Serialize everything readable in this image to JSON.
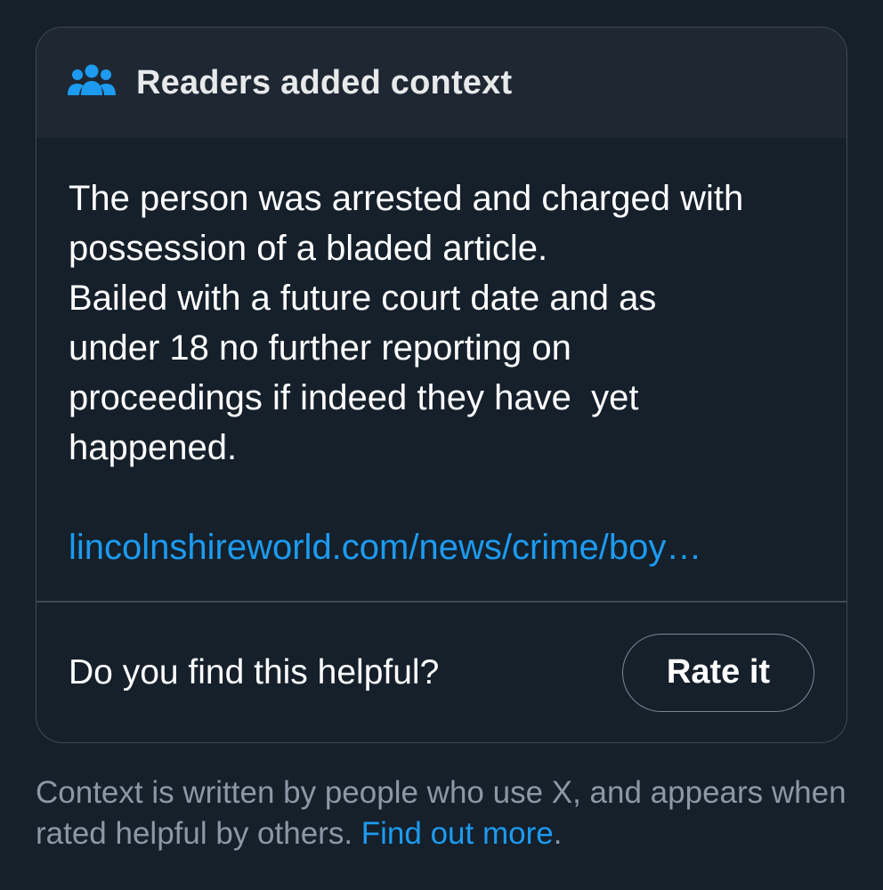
{
  "note": {
    "header_title": "Readers added context",
    "header_icon": "people-group-icon",
    "text": "The person was arrested and charged with\npossession of a bladed article.\nBailed with a future court date and as\nunder 18 no further reporting on\nproceedings if indeed they have  yet\nhappened.",
    "link": "lincolnshireworld.com/news/crime/boy…"
  },
  "feedback": {
    "question": "Do you find this helpful?",
    "rate_label": "Rate it"
  },
  "footnote": {
    "text": "Context is written by people who use X, and appears when rated helpful by others.  ",
    "link_label": "Find out more",
    "trailing": "."
  },
  "colors": {
    "background": "#15202b",
    "header_background": "#1e2732",
    "accent": "#1d9bf0",
    "muted_text": "#8b98a5",
    "border": "#3e4a55"
  }
}
